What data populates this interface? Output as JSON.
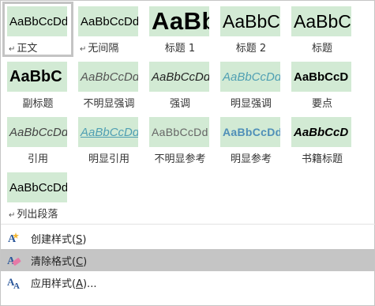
{
  "styles": [
    {
      "preview": "AaBbCcDd",
      "label": "正文",
      "para_mark": true,
      "cls": "s-normal",
      "selected": true
    },
    {
      "preview": "AaBbCcDd",
      "label": "无间隔",
      "para_mark": true,
      "cls": "s-nospace"
    },
    {
      "preview": "AaBb",
      "label": "标题 1",
      "para_mark": false,
      "cls": "s-h1"
    },
    {
      "preview": "AaBbC",
      "label": "标题 2",
      "para_mark": false,
      "cls": "s-h2"
    },
    {
      "preview": "AaBbC",
      "label": "标题",
      "para_mark": false,
      "cls": "s-title"
    },
    {
      "preview": "AaBbC",
      "label": "副标题",
      "para_mark": false,
      "cls": "s-subtitle"
    },
    {
      "preview": "AaBbCcDd",
      "label": "不明显强调",
      "para_mark": false,
      "cls": "s-subtleem"
    },
    {
      "preview": "AaBbCcDd",
      "label": "强调",
      "para_mark": false,
      "cls": "s-em"
    },
    {
      "preview": "AaBbCcDd",
      "label": "明显强调",
      "para_mark": false,
      "cls": "s-intem"
    },
    {
      "preview": "AaBbCcD",
      "label": "要点",
      "para_mark": false,
      "cls": "s-strong"
    },
    {
      "preview": "AaBbCcDd",
      "label": "引用",
      "para_mark": false,
      "cls": "s-quote"
    },
    {
      "preview": "AaBbCcDd",
      "label": "明显引用",
      "para_mark": false,
      "cls": "s-intquote"
    },
    {
      "preview": "AaBbCcDd",
      "label": "不明显参考",
      "para_mark": false,
      "cls": "s-subref"
    },
    {
      "preview": "AaBbCcDd",
      "label": "明显参考",
      "para_mark": false,
      "cls": "s-intref"
    },
    {
      "preview": "AaBbCcD",
      "label": "书籍标题",
      "para_mark": false,
      "cls": "s-book"
    },
    {
      "preview": "AaBbCcDd",
      "label": "列出段落",
      "para_mark": true,
      "cls": "s-list"
    }
  ],
  "menu": {
    "create_style": {
      "text": "创建样式(",
      "accel": "S",
      "tail": ")",
      "icon": "create-style-icon"
    },
    "clear_formatting": {
      "text": "清除格式(",
      "accel": "C",
      "tail": ")",
      "icon": "eraser-icon"
    },
    "apply_styles": {
      "text": "应用样式(",
      "accel": "A",
      "tail": ")...",
      "icon": "apply-styles-icon"
    }
  },
  "colors": {
    "swatch_bg": "#d2ead4",
    "hover_bg": "#c5c5c5",
    "accent_blue": "#4f9fb3"
  }
}
